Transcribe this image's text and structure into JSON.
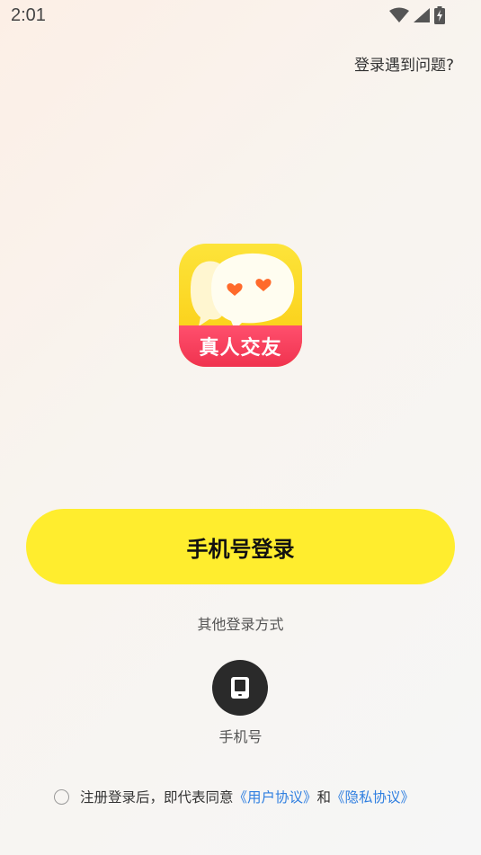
{
  "status_bar": {
    "time": "2:01",
    "icons": [
      "wifi-icon",
      "cell-signal-icon",
      "battery-charging-icon"
    ]
  },
  "header": {
    "help_link": "登录遇到问题?"
  },
  "logo": {
    "banner_text": "真人交友",
    "colors": {
      "yellow": "#fcd920",
      "red": "#f0334f"
    }
  },
  "login": {
    "button_label": "手机号登录",
    "button_color": "#ffed2e"
  },
  "other_login": {
    "title": "其他登录方式",
    "methods": [
      {
        "label": "手机号",
        "icon": "phone-icon"
      }
    ]
  },
  "agreement": {
    "prefix": "注册登录后，即代表同意",
    "user_agreement": "《用户协议》",
    "conjunction": "和",
    "privacy_policy": "《隐私协议》",
    "link_color": "#2f7fe0"
  }
}
